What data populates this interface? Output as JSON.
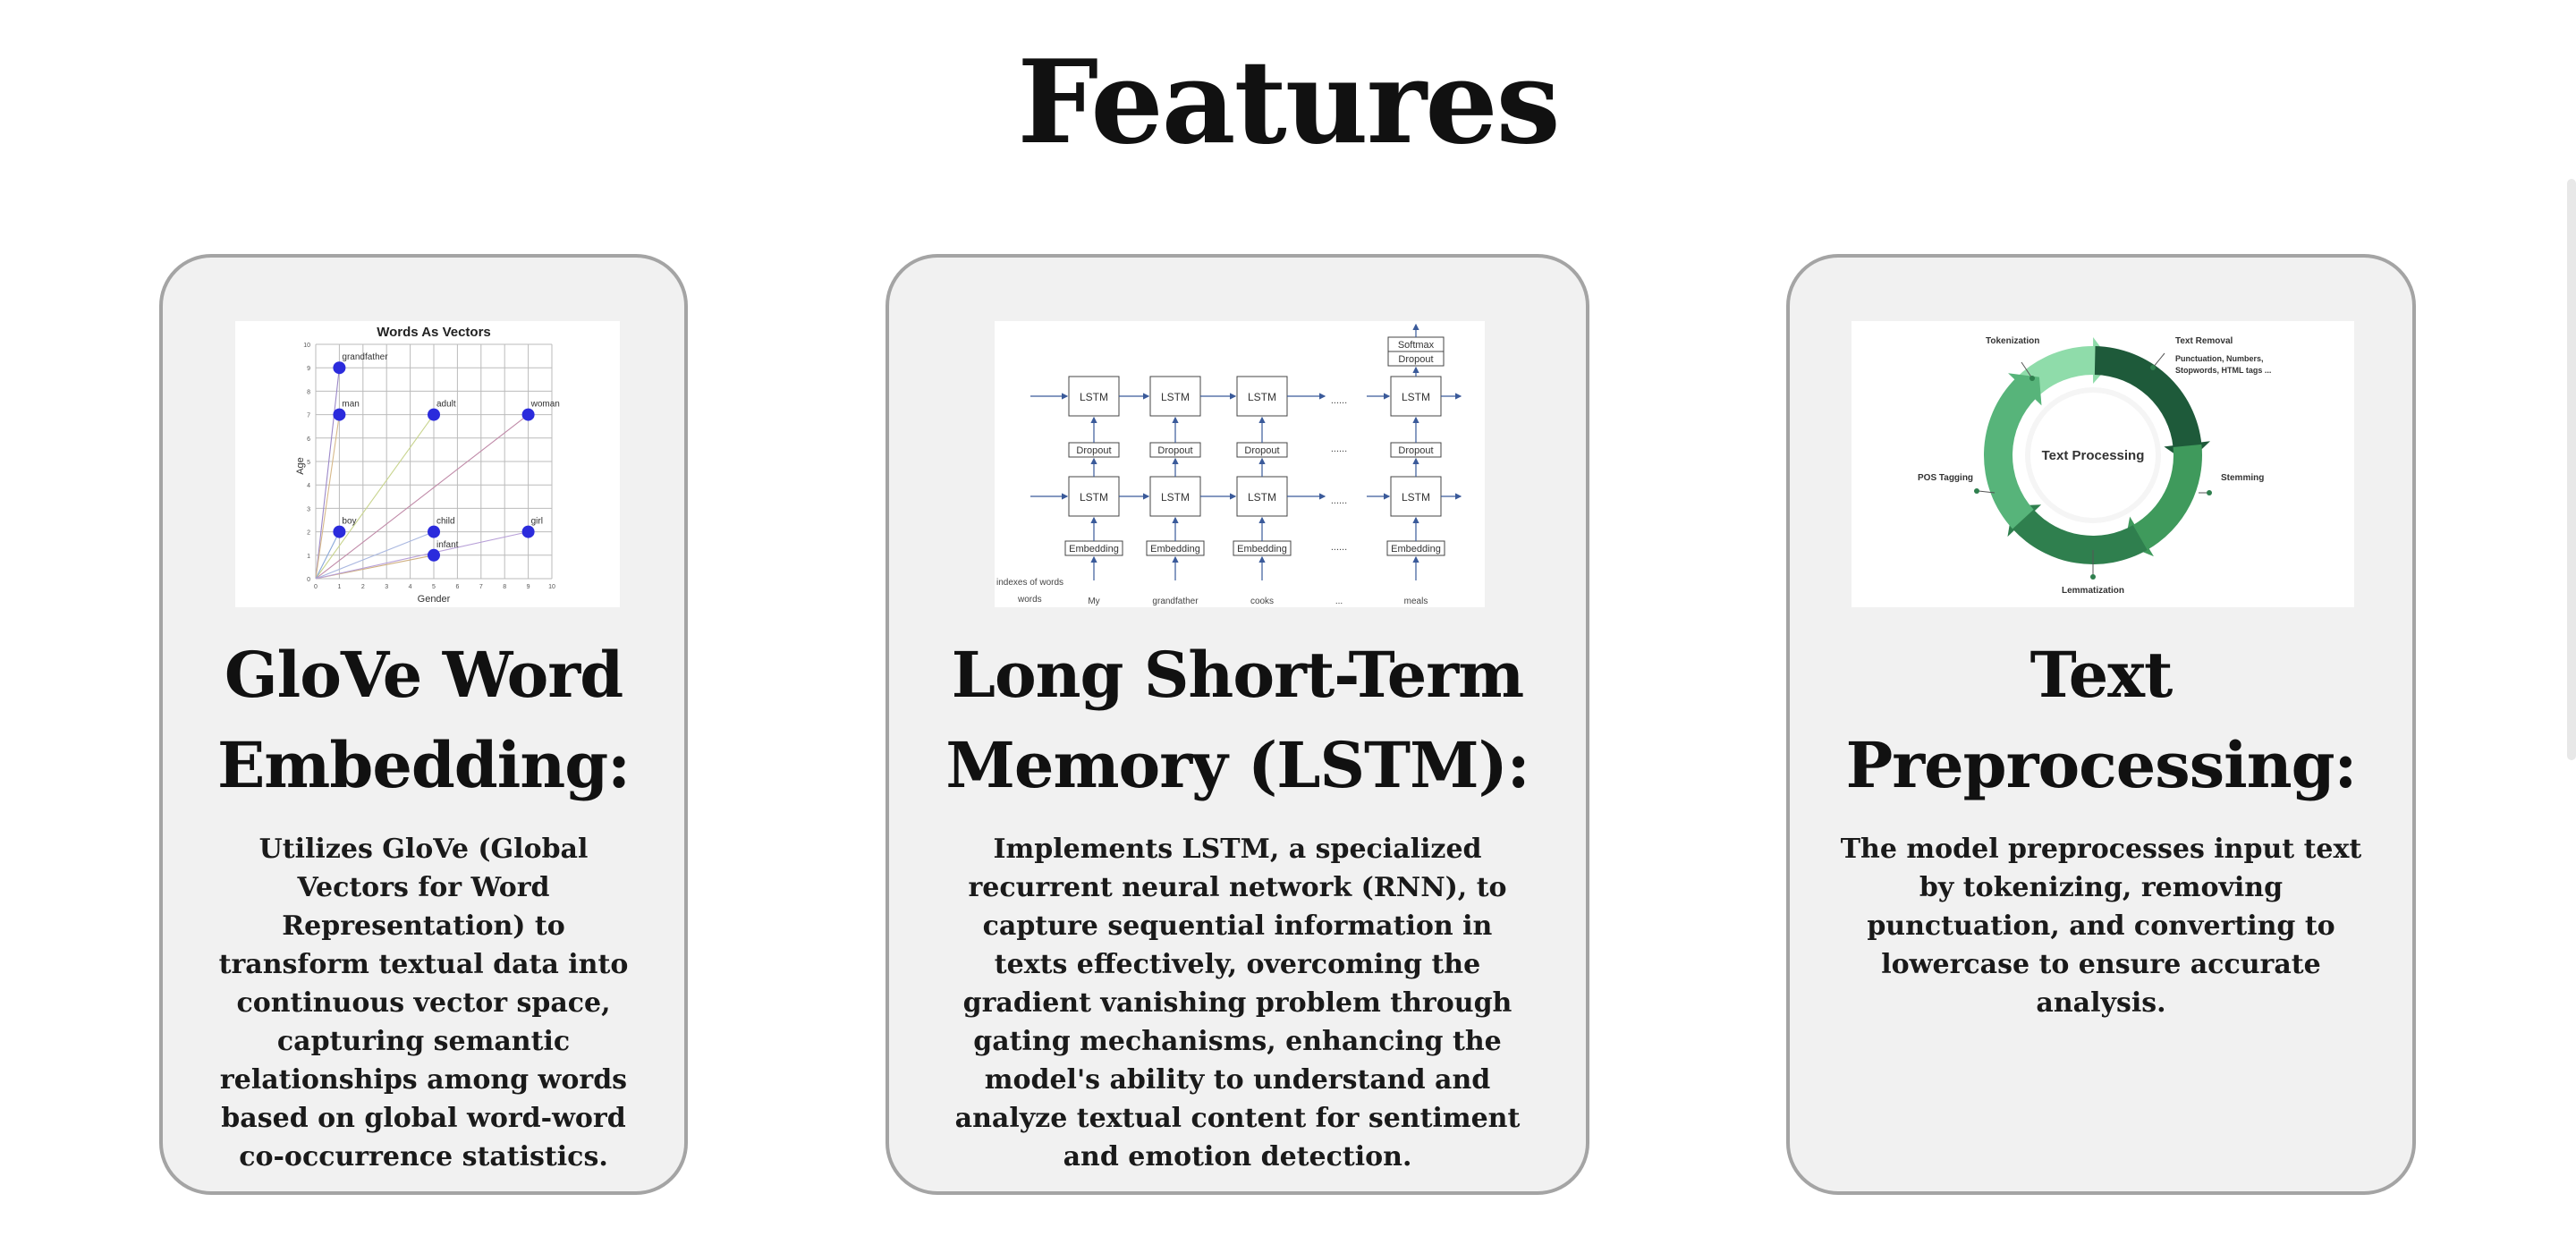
{
  "page": {
    "heading": "Features"
  },
  "cards": [
    {
      "title": "GloVe Word Embedding:",
      "description": "Utilizes GloVe (Global Vectors for Word Representation) to transform textual data into continuous vector space, capturing semantic relationships among words based on global word-word co-occurrence statistics.",
      "figure": {
        "title": "Words As Vectors",
        "xlabel": "Gender",
        "ylabel": "Age",
        "points": [
          {
            "label": "grandfather",
            "x": 1,
            "y": 9
          },
          {
            "label": "man",
            "x": 1,
            "y": 7
          },
          {
            "label": "adult",
            "x": 5,
            "y": 7
          },
          {
            "label": "woman",
            "x": 9,
            "y": 7
          },
          {
            "label": "boy",
            "x": 1,
            "y": 2
          },
          {
            "label": "child",
            "x": 5,
            "y": 2
          },
          {
            "label": "infant",
            "x": 5,
            "y": 1
          },
          {
            "label": "girl",
            "x": 9,
            "y": 2
          }
        ]
      }
    },
    {
      "title": "Long Short-Term Memory (LSTM):",
      "description": "Implements LSTM, a specialized recurrent neural network (RNN), to capture sequential information in texts effectively, overcoming the gradient vanishing problem through gating mechanisms, enhancing the model's ability to understand and analyze textual content for sentiment and emotion detection.",
      "figure": {
        "cell": "LSTM",
        "dropout": "Dropout",
        "embedding": "Embedding",
        "softmax": "Softmax",
        "ellipsis": "......",
        "row_label_1": "indexes of words",
        "row_label_2": "words",
        "words": [
          "My",
          "grandfather",
          "cooks",
          "...",
          "meals"
        ]
      }
    },
    {
      "title": "Text Preprocessing:",
      "description": "The model preprocesses input text by tokenizing, removing punctuation, and converting to lowercase to ensure accurate analysis.",
      "figure": {
        "center": "Text Processing",
        "tokenization": "Tokenization",
        "text_removal": "Text Removal",
        "removal_detail_1": "Punctuation, Numbers,",
        "removal_detail_2": "Stopwords, HTML tags ...",
        "stemming": "Stemming",
        "lemmatization": "Lemmatization",
        "pos_tagging": "POS Tagging",
        "colors": [
          "#1e5a3a",
          "#2f7f4e",
          "#3f9a5c",
          "#57b47a",
          "#8fdcaa"
        ]
      }
    }
  ]
}
